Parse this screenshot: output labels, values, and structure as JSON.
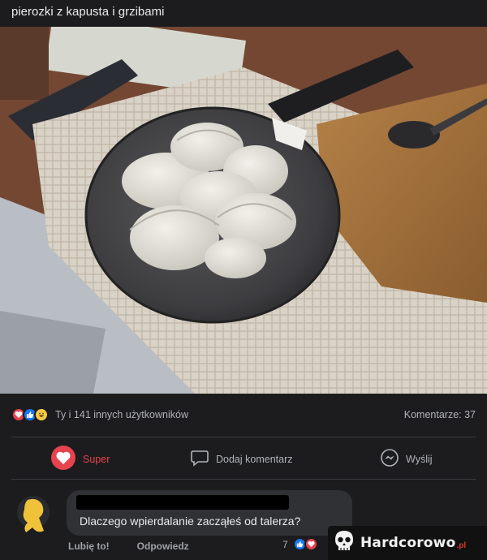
{
  "post": {
    "title": "pierozki z kapusta i grzibami"
  },
  "reactions": {
    "icons": [
      "heart-reaction",
      "like-reaction",
      "haha-reaction"
    ],
    "summary": "Ty i 141 innych użytkowników",
    "comments": "Komentarze: 37"
  },
  "actions": {
    "super": "Super",
    "comment": "Dodaj komentarz",
    "send": "Wyślij"
  },
  "comment": {
    "text": "Dlaczego wpierdalanie zacząłeś od talerza?",
    "like": "Lubię to!",
    "reply": "Odpowiedz",
    "reaction_count": "7",
    "reaction_icons": [
      "like-reaction",
      "heart-reaction"
    ]
  },
  "watermark": {
    "text": "Hardcorowo",
    "suffix": ".pl"
  },
  "colors": {
    "background": "#1c1c1e",
    "super_red": "#e6434e",
    "like_blue": "#1877f2",
    "haha_yellow": "#f7c948",
    "bubble": "#303134"
  }
}
